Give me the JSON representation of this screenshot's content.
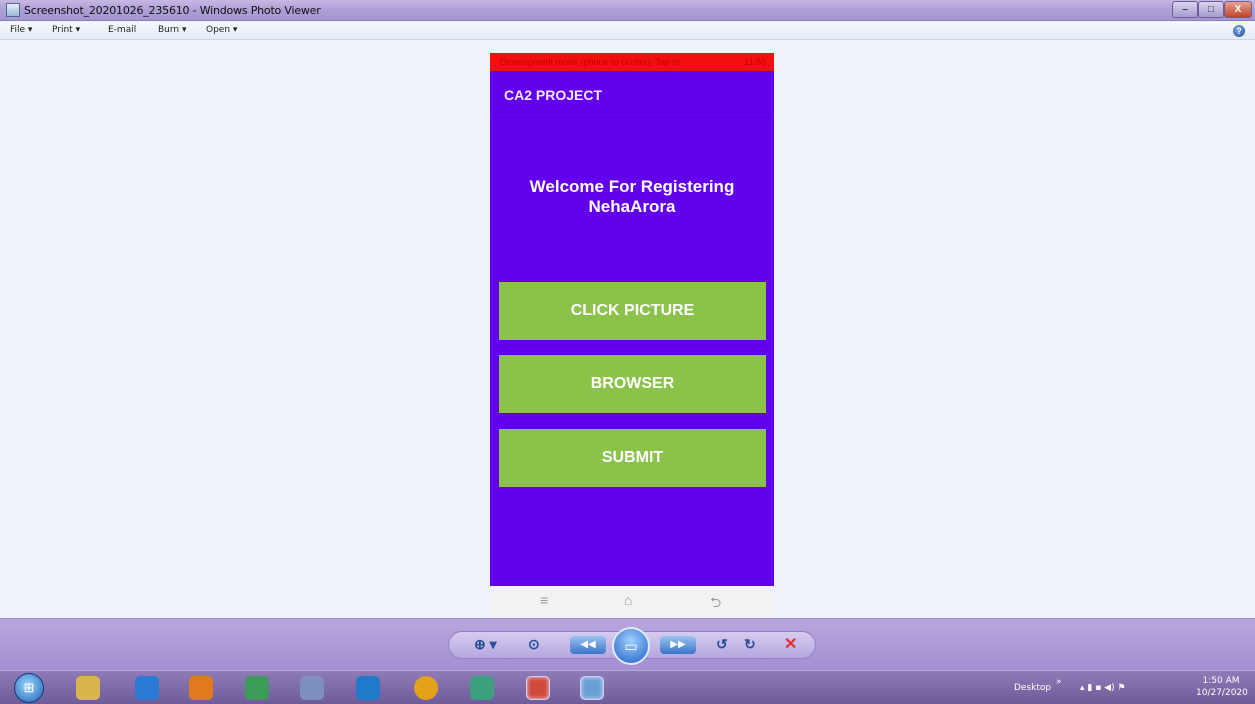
{
  "window": {
    "title": "Screenshot_20201026_235610 - Windows Photo Viewer",
    "min_glyph": "–",
    "max_glyph": "□",
    "close_glyph": "X"
  },
  "menu": {
    "file": "File  ▾",
    "print": "Print  ▾",
    "email": "E-mail",
    "burn": "Burn  ▾",
    "open": "Open  ▾",
    "help_glyph": "?"
  },
  "phone": {
    "dev_banner": "Development mode (phone to cluster). Tap to",
    "dev_time": "11:50",
    "appbar_title": "CA2 PROJECT",
    "welcome_line1": "Welcome For Registering",
    "welcome_line2": "NehaArora",
    "buttons": {
      "click_picture": "CLICK PICTURE",
      "browser": "BROWSER",
      "submit": "SUBMIT"
    },
    "nav": {
      "menu": "≡",
      "home": "⌂",
      "back": "⮌"
    }
  },
  "viewer_toolbar": {
    "zoom": "⊕ ▾",
    "actual_size": "⊙",
    "prev": "◀◀",
    "slideshow": "▭",
    "next": "▶▶",
    "rotate_ccw": "↺",
    "rotate_cw": "↻",
    "delete": "✕"
  },
  "taskbar": {
    "start_glyph": "⊞",
    "desktop_label": "Desktop",
    "tray_overflow": "»",
    "tray_icons": "▴  ▮  ▪  ◀)  ⚑",
    "time": "1:50 AM",
    "date": "10/27/2020"
  },
  "colors": {
    "phone_bg": "#6200ee",
    "button_bg": "#8bc34a",
    "dev_banner": "#f40f0f"
  }
}
